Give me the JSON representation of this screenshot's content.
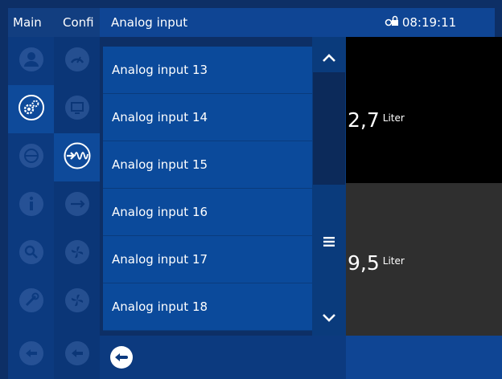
{
  "header": {
    "tab_main": "Main",
    "tab_config": "Confi",
    "title": "Analog input",
    "time": "08:19:11"
  },
  "list": {
    "items": [
      {
        "label": "Analog input 13"
      },
      {
        "label": "Analog input 14"
      },
      {
        "label": "Analog input 15"
      },
      {
        "label": "Analog input 16"
      },
      {
        "label": "Analog input 17"
      },
      {
        "label": "Analog input 18"
      }
    ]
  },
  "readings": [
    {
      "value": "2,7",
      "unit": "Liter"
    },
    {
      "value": "9,5",
      "unit": "Liter"
    }
  ],
  "colors": {
    "accent": "#0f4594",
    "list_item": "#0b4a9b",
    "reading_top_bg": "#000000",
    "reading_bottom_bg": "#2f2f2f"
  },
  "icons": {
    "sidebar_col1": [
      "user-icon",
      "settings-gear-icon",
      "globe-icon",
      "info-icon",
      "search-icon",
      "wrench-icon",
      "back-icon"
    ],
    "sidebar_col2": [
      "gauge-icon",
      "display-icon",
      "analog-input-icon",
      "network-icon",
      "fan-icon",
      "fan-icon",
      "back-icon"
    ],
    "status": "lock-icon",
    "scroll_up": "chevron-up-icon",
    "scroll_menu": "menu-icon",
    "scroll_down": "chevron-down-icon",
    "back": "back-arrow-icon"
  }
}
